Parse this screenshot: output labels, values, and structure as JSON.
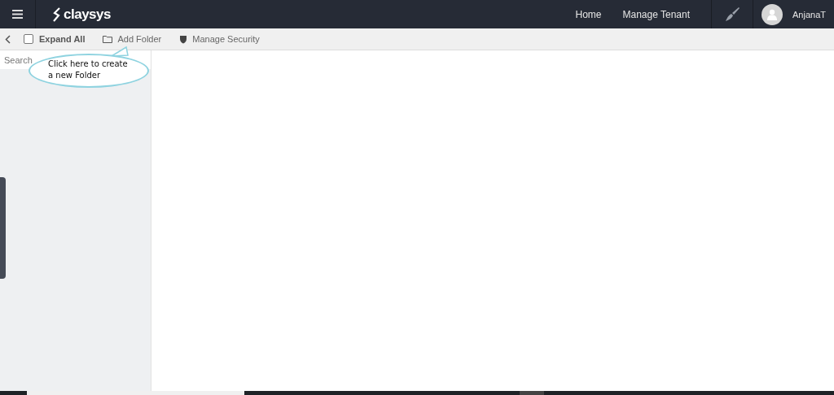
{
  "header": {
    "logo": "claysys",
    "nav": [
      {
        "label": "Home"
      },
      {
        "label": "Manage Tenant"
      }
    ],
    "user": "AnjanaT"
  },
  "toolbar": {
    "expand_all": {
      "label": "Expand All",
      "checked": false
    },
    "actions": [
      {
        "label": "Add Folder",
        "kind": "folder"
      },
      {
        "label": "Manage Security",
        "kind": "shield"
      }
    ]
  },
  "sidebar": {
    "search": {
      "placeholder": "Search"
    }
  },
  "callout": {
    "text": "Click here to create a new Folder"
  }
}
